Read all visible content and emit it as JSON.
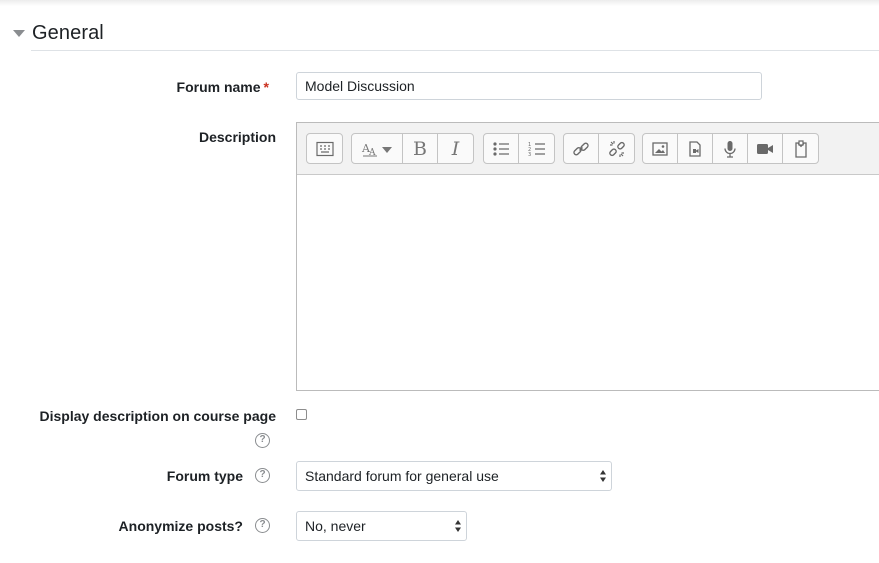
{
  "section": {
    "title": "General"
  },
  "fields": {
    "forum_name": {
      "label": "Forum name",
      "required_mark": "*",
      "value": "Model Discussion"
    },
    "description": {
      "label": "Description",
      "toolbar_icons": [
        "show-more-icon",
        "text-style-icon",
        "bold-icon",
        "italic-icon",
        "unordered-list-icon",
        "ordered-list-icon",
        "link-icon",
        "unlink-icon",
        "image-icon",
        "media-icon",
        "microphone-icon",
        "video-icon",
        "manage-files-icon"
      ],
      "bold_glyph": "B",
      "italic_glyph": "I",
      "value": ""
    },
    "display_description": {
      "label": "Display description on course page",
      "checked": false
    },
    "forum_type": {
      "label": "Forum type",
      "selected": "Standard forum for general use"
    },
    "anonymize": {
      "label": "Anonymize posts?",
      "selected": "No, never"
    },
    "help_glyph": "?"
  },
  "colors": {
    "required": "#ca3120",
    "text": "#1d2125",
    "icon": "#8a8d90"
  }
}
